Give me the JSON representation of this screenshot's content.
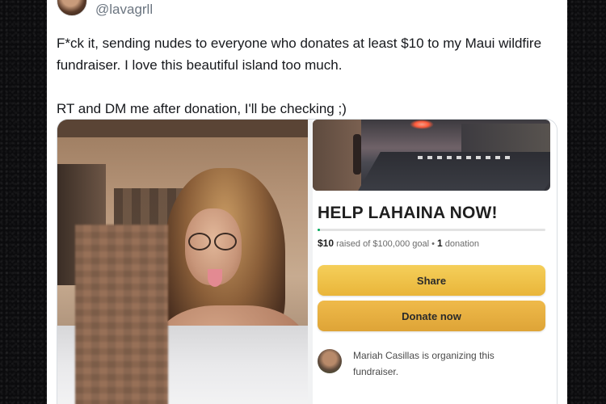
{
  "tweet": {
    "handle": "@lavagrll",
    "text": "F*ck it, sending nudes to everyone who donates at least $10 to my Maui wildfire fundraiser. I love this beautiful island too much.\n\nRT and DM me after donation, I'll be checking ;)"
  },
  "fundraiser": {
    "title": "HELP LAHAINA NOW!",
    "raised": "$10",
    "progress_text": " raised of $100,000 goal • ",
    "donation_count": "1",
    "donation_label": " donation",
    "progress_fraction": 0.0001,
    "share_label": "Share",
    "donate_label": "Donate now",
    "organizer_text": "Mariah Casillas is organizing this fundraiser."
  },
  "colors": {
    "button": "#eeb945",
    "progress": "#02a95c"
  }
}
